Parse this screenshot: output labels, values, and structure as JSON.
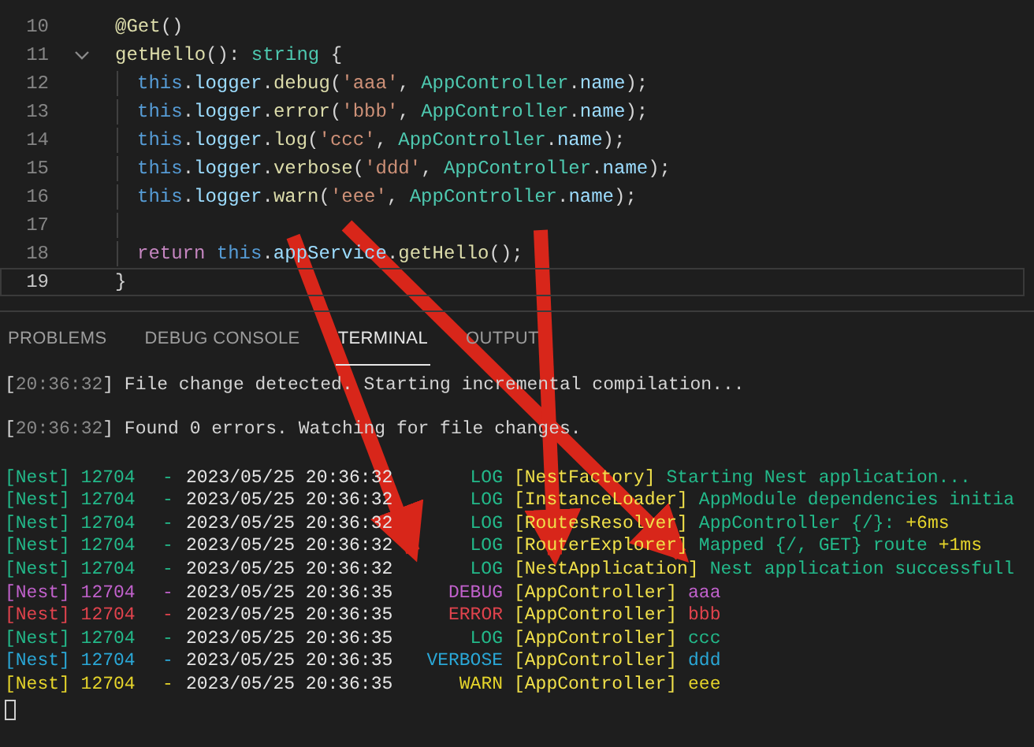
{
  "editor": {
    "lines": [
      {
        "number": "10",
        "block": false,
        "fold": false,
        "current": false,
        "tokens": [
          {
            "t": "@Get",
            "kind": "fn"
          },
          {
            "t": "()",
            "kind": "punct"
          }
        ]
      },
      {
        "number": "11",
        "block": false,
        "fold": true,
        "current": false,
        "tokens": [
          {
            "t": "getHello",
            "kind": "fn"
          },
          {
            "t": "():",
            "kind": "punct"
          },
          {
            "t": "string",
            "kind": "type",
            "spaced": true
          },
          {
            "t": "{",
            "kind": "punct",
            "spaced": true
          }
        ]
      },
      {
        "number": "12",
        "block": true,
        "fold": false,
        "current": false,
        "tokens": [
          {
            "t": "this",
            "kind": "kw"
          },
          {
            "t": ".",
            "kind": "punct"
          },
          {
            "t": "logger",
            "kind": "prop"
          },
          {
            "t": ".",
            "kind": "punct"
          },
          {
            "t": "debug",
            "kind": "fn"
          },
          {
            "t": "(",
            "kind": "punct"
          },
          {
            "t": "'aaa'",
            "kind": "str"
          },
          {
            "t": ",",
            "kind": "punct"
          },
          {
            "t": "AppController",
            "kind": "type",
            "spaced": true
          },
          {
            "t": ".",
            "kind": "punct"
          },
          {
            "t": "name",
            "kind": "prop"
          },
          {
            "t": ");",
            "kind": "punct"
          }
        ]
      },
      {
        "number": "13",
        "block": true,
        "fold": false,
        "current": false,
        "tokens": [
          {
            "t": "this",
            "kind": "kw"
          },
          {
            "t": ".",
            "kind": "punct"
          },
          {
            "t": "logger",
            "kind": "prop"
          },
          {
            "t": ".",
            "kind": "punct"
          },
          {
            "t": "error",
            "kind": "fn"
          },
          {
            "t": "(",
            "kind": "punct"
          },
          {
            "t": "'bbb'",
            "kind": "str"
          },
          {
            "t": ",",
            "kind": "punct"
          },
          {
            "t": "AppController",
            "kind": "type",
            "spaced": true
          },
          {
            "t": ".",
            "kind": "punct"
          },
          {
            "t": "name",
            "kind": "prop"
          },
          {
            "t": ");",
            "kind": "punct"
          }
        ]
      },
      {
        "number": "14",
        "block": true,
        "fold": false,
        "current": false,
        "tokens": [
          {
            "t": "this",
            "kind": "kw"
          },
          {
            "t": ".",
            "kind": "punct"
          },
          {
            "t": "logger",
            "kind": "prop"
          },
          {
            "t": ".",
            "kind": "punct"
          },
          {
            "t": "log",
            "kind": "fn"
          },
          {
            "t": "(",
            "kind": "punct"
          },
          {
            "t": "'ccc'",
            "kind": "str"
          },
          {
            "t": ",",
            "kind": "punct"
          },
          {
            "t": "AppController",
            "kind": "type",
            "spaced": true
          },
          {
            "t": ".",
            "kind": "punct"
          },
          {
            "t": "name",
            "kind": "prop"
          },
          {
            "t": ");",
            "kind": "punct"
          }
        ]
      },
      {
        "number": "15",
        "block": true,
        "fold": false,
        "current": false,
        "tokens": [
          {
            "t": "this",
            "kind": "kw"
          },
          {
            "t": ".",
            "kind": "punct"
          },
          {
            "t": "logger",
            "kind": "prop"
          },
          {
            "t": ".",
            "kind": "punct"
          },
          {
            "t": "verbose",
            "kind": "fn"
          },
          {
            "t": "(",
            "kind": "punct"
          },
          {
            "t": "'ddd'",
            "kind": "str"
          },
          {
            "t": ",",
            "kind": "punct"
          },
          {
            "t": "AppController",
            "kind": "type",
            "spaced": true
          },
          {
            "t": ".",
            "kind": "punct"
          },
          {
            "t": "name",
            "kind": "prop"
          },
          {
            "t": ");",
            "kind": "punct"
          }
        ]
      },
      {
        "number": "16",
        "block": true,
        "fold": false,
        "current": false,
        "tokens": [
          {
            "t": "this",
            "kind": "kw"
          },
          {
            "t": ".",
            "kind": "punct"
          },
          {
            "t": "logger",
            "kind": "prop"
          },
          {
            "t": ".",
            "kind": "punct"
          },
          {
            "t": "warn",
            "kind": "fn"
          },
          {
            "t": "(",
            "kind": "punct"
          },
          {
            "t": "'eee'",
            "kind": "str"
          },
          {
            "t": ",",
            "kind": "punct"
          },
          {
            "t": "AppController",
            "kind": "type",
            "spaced": true
          },
          {
            "t": ".",
            "kind": "punct"
          },
          {
            "t": "name",
            "kind": "prop"
          },
          {
            "t": ");",
            "kind": "punct"
          }
        ]
      },
      {
        "number": "17",
        "block": true,
        "fold": false,
        "current": false
      },
      {
        "number": "18",
        "block": true,
        "fold": false,
        "current": false,
        "tokens": [
          {
            "t": "return",
            "kind": "ctrl"
          },
          {
            "t": "this",
            "kind": "kw",
            "spaced": true
          },
          {
            "t": ".",
            "kind": "punct"
          },
          {
            "t": "appService",
            "kind": "prop"
          },
          {
            "t": ".",
            "kind": "punct"
          },
          {
            "t": "getHello",
            "kind": "fn"
          },
          {
            "t": "();",
            "kind": "punct"
          }
        ]
      },
      {
        "number": "19",
        "block": false,
        "fold": false,
        "current": true,
        "tokens": [
          {
            "t": "}",
            "kind": "punct"
          }
        ]
      }
    ]
  },
  "panel": {
    "tabs": [
      {
        "label": "PROBLEMS",
        "selected": false
      },
      {
        "label": "DEBUG CONSOLE",
        "selected": false
      },
      {
        "label": "TERMINAL",
        "selected": true
      },
      {
        "label": "OUTPUT",
        "selected": false
      }
    ],
    "messages": [
      [
        {
          "t": "[",
          "kind": "punct"
        },
        {
          "t": "20:36:32",
          "kind": "dim"
        },
        {
          "t": "] File change detected. Starting incremental compilation...",
          "kind": "punct"
        }
      ],
      [
        {
          "t": "[",
          "kind": "punct"
        },
        {
          "t": "20:36:32",
          "kind": "dim"
        },
        {
          "t": "] Found 0 errors. Watching for file changes.",
          "kind": "punct"
        }
      ]
    ],
    "logs": [
      {
        "kind": "log",
        "source": "[Nest] 12704",
        "dash": "-",
        "timestamp": "2023/05/25 20:36:32",
        "level": "LOG",
        "context": "[NestFactory]",
        "message": "Starting Nest application..."
      },
      {
        "kind": "log",
        "source": "[Nest] 12704",
        "dash": "-",
        "timestamp": "2023/05/25 20:36:32",
        "level": "LOG",
        "context": "[InstanceLoader]",
        "message": "AppModule dependencies initia"
      },
      {
        "kind": "log",
        "source": "[Nest] 12704",
        "dash": "-",
        "timestamp": "2023/05/25 20:36:32",
        "level": "LOG",
        "context": "[RoutesResolver]",
        "message": "AppController {/}:",
        "timing": "+6ms"
      },
      {
        "kind": "log",
        "source": "[Nest] 12704",
        "dash": "-",
        "timestamp": "2023/05/25 20:36:32",
        "level": "LOG",
        "context": "[RouterExplorer]",
        "message": "Mapped {/, GET} route",
        "timing": "+1ms"
      },
      {
        "kind": "log",
        "source": "[Nest] 12704",
        "dash": "-",
        "timestamp": "2023/05/25 20:36:32",
        "level": "LOG",
        "context": "[NestApplication]",
        "message": "Nest application successfull"
      },
      {
        "kind": "debug",
        "source": "[Nest] 12704",
        "dash": "-",
        "timestamp": "2023/05/25 20:36:35",
        "level": "DEBUG",
        "context": "[AppController]",
        "message": "aaa"
      },
      {
        "kind": "error",
        "source": "[Nest] 12704",
        "dash": "-",
        "timestamp": "2023/05/25 20:36:35",
        "level": "ERROR",
        "context": "[AppController]",
        "message": "bbb"
      },
      {
        "kind": "log",
        "source": "[Nest] 12704",
        "dash": "-",
        "timestamp": "2023/05/25 20:36:35",
        "level": "LOG",
        "context": "[AppController]",
        "message": "ccc"
      },
      {
        "kind": "verbose",
        "source": "[Nest] 12704",
        "dash": "-",
        "timestamp": "2023/05/25 20:36:35",
        "level": "VERBOSE",
        "context": "[AppController]",
        "message": "ddd"
      },
      {
        "kind": "warn",
        "source": "[Nest] 12704",
        "dash": "-",
        "timestamp": "2023/05/25 20:36:35",
        "level": "WARN",
        "context": "[AppController]",
        "message": "eee"
      }
    ]
  }
}
